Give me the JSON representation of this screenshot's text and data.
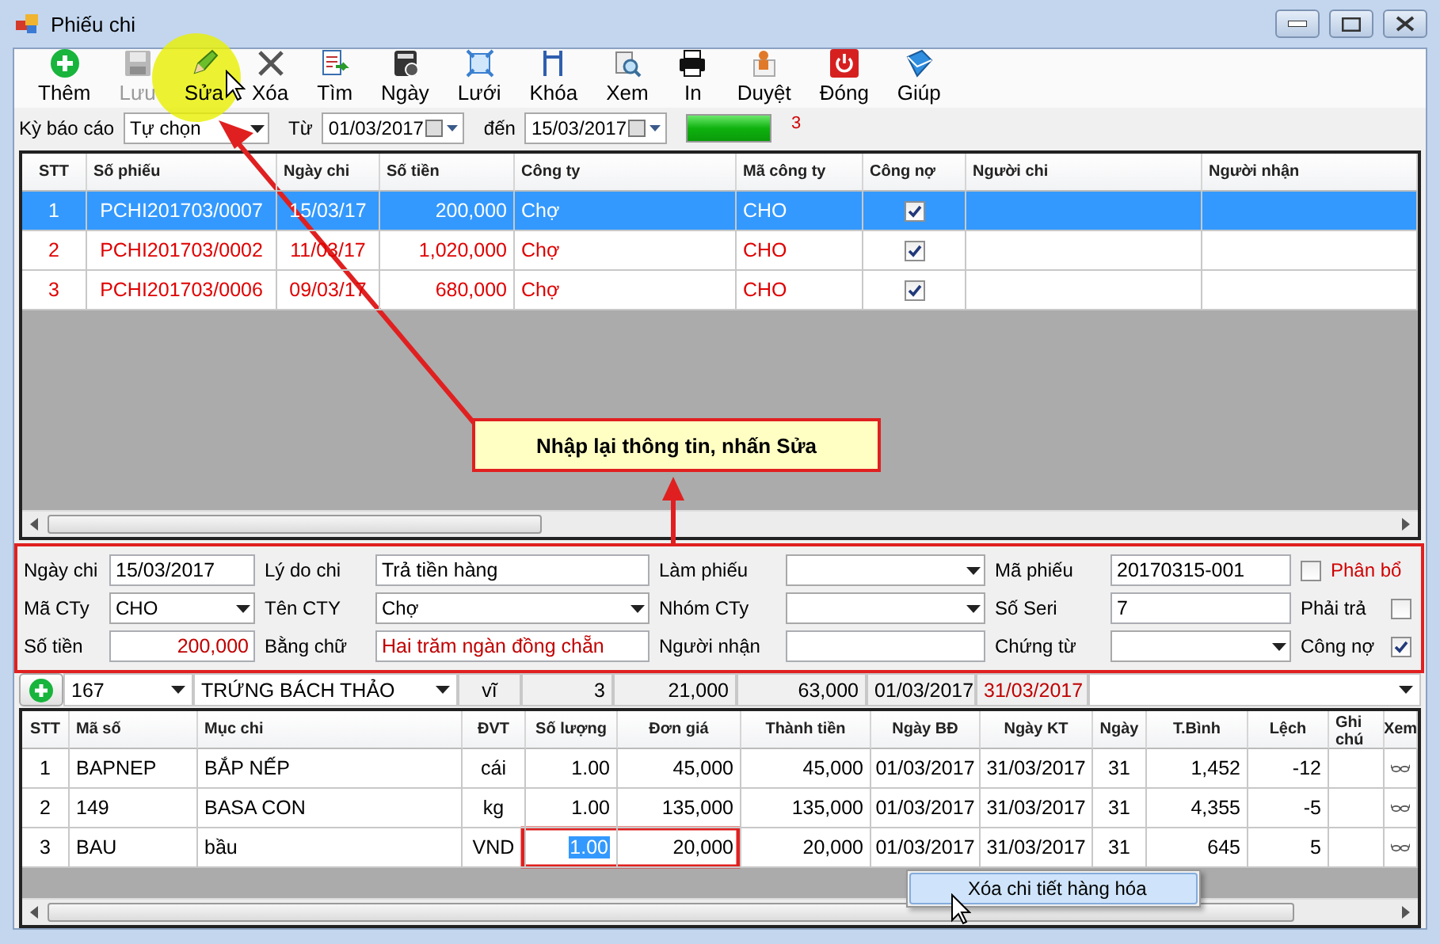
{
  "window": {
    "title": "Phiếu chi"
  },
  "toolbar": [
    {
      "label": "Thêm",
      "kind": "add",
      "disabled": false
    },
    {
      "label": "Lưu",
      "kind": "save",
      "disabled": true
    },
    {
      "label": "Sửa",
      "kind": "edit",
      "disabled": false
    },
    {
      "label": "Xóa",
      "kind": "delete",
      "disabled": false
    },
    {
      "label": "Tìm",
      "kind": "find",
      "disabled": false
    },
    {
      "label": "Ngày",
      "kind": "date",
      "disabled": false
    },
    {
      "label": "Lưới",
      "kind": "grid",
      "disabled": false
    },
    {
      "label": "Khóa",
      "kind": "lock",
      "disabled": false
    },
    {
      "label": "Xem",
      "kind": "preview",
      "disabled": false
    },
    {
      "label": "In",
      "kind": "print",
      "disabled": false
    },
    {
      "label": "Duyệt",
      "kind": "approve",
      "disabled": false
    },
    {
      "label": "Đóng",
      "kind": "close",
      "disabled": false
    },
    {
      "label": "Giúp",
      "kind": "help",
      "disabled": false
    }
  ],
  "filter": {
    "period_label": "Kỳ báo cáo",
    "period": "Tự chọn",
    "from_label": "Từ",
    "from": "01/03/2017",
    "to_label": "đến",
    "to": "15/03/2017",
    "progress": {
      "level": 1
    },
    "count": "3"
  },
  "vouchers": {
    "columns": [
      "STT",
      "Số phiếu",
      "Ngày chi",
      "Số tiền",
      "Công ty",
      "Mã công ty",
      "Công nợ",
      "Người chi",
      "Người nhận"
    ],
    "rows": [
      {
        "stt": "1",
        "number": "PCHI201703/0007",
        "date": "15/03/17",
        "amount": "200,000",
        "company": "Chợ",
        "code": "CHO",
        "debt": true,
        "selected": true
      },
      {
        "stt": "2",
        "number": "PCHI201703/0002",
        "date": "11/03/17",
        "amount": "1,020,000",
        "company": "Chợ",
        "code": "CHO",
        "debt": true,
        "selected": false
      },
      {
        "stt": "3",
        "number": "PCHI201703/0006",
        "date": "09/03/17",
        "amount": "680,000",
        "company": "Chợ",
        "code": "CHO",
        "debt": true,
        "selected": false
      }
    ]
  },
  "form": {
    "rows": [
      {
        "fields": [
          {
            "label": "Ngày chi",
            "kind": "text",
            "value": "15/03/2017"
          },
          {
            "label": "Lý do chi",
            "kind": "text",
            "value": "Trả tiền hàng"
          },
          {
            "label": "Làm phiếu",
            "kind": "combo"
          },
          {
            "label": "Mã phiếu",
            "kind": "text",
            "value": "20170315-001"
          }
        ],
        "option": {
          "label": "Phân bổ",
          "checked": false,
          "box_first": true,
          "alert": true
        }
      },
      {
        "fields": [
          {
            "label": "Mã CTy",
            "kind": "combo",
            "value": "CHO"
          },
          {
            "label": "Tên CTY",
            "kind": "combo",
            "value": "Chợ"
          },
          {
            "label": "Nhóm CTy",
            "kind": "combo"
          },
          {
            "label": "Số Seri",
            "kind": "text",
            "value": "7"
          }
        ],
        "option": {
          "label": "Phải trả",
          "checked": false,
          "box_first": false,
          "alert": false
        }
      },
      {
        "fields": [
          {
            "label": "Số tiền",
            "kind": "text",
            "value": "200,000",
            "alert": true,
            "numeric": true
          },
          {
            "label": "Bằng chữ",
            "kind": "text",
            "value": "Hai trăm ngàn đồng chẵn",
            "alert": true
          },
          {
            "label": "Người nhận",
            "kind": "text"
          },
          {
            "label": "Chứng từ",
            "kind": "combo"
          }
        ],
        "option": {
          "label": "Công nợ",
          "checked": true,
          "box_first": false,
          "alert": false
        }
      }
    ]
  },
  "entry": {
    "code": "167",
    "item": "TRỨNG BÁCH THẢO",
    "unit": "vĩ",
    "quantity": "3",
    "price": "21,000",
    "total": "63,000",
    "start": "01/03/2017",
    "end": "31/03/2017"
  },
  "details": {
    "columns": [
      "STT",
      "Mã số",
      "Mục chi",
      "ĐVT",
      "Số lượng",
      "Đơn giá",
      "Thành tiền",
      "Ngày BĐ",
      "Ngày KT",
      "Ngày",
      "T.Bình",
      "Lệch",
      "Ghi chú",
      "Xem"
    ],
    "rows": [
      {
        "cells": [
          "1",
          "BAPNEP",
          "BẮP NẾP",
          "cái",
          "1.00",
          "45,000",
          "45,000",
          "01/03/2017",
          "31/03/2017",
          "31",
          "1,452",
          "-12"
        ],
        "quantity_selected": false
      },
      {
        "cells": [
          "2",
          "149",
          "BASA CON",
          "kg",
          "1.00",
          "135,000",
          "135,000",
          "01/03/2017",
          "31/03/2017",
          "31",
          "4,355",
          "-5"
        ],
        "quantity_selected": false
      },
      {
        "cells": [
          "3",
          "BAU",
          "bầu",
          "VND",
          "1.00",
          "20,000",
          "20,000",
          "01/03/2017",
          "31/03/2017",
          "31",
          "645",
          "5"
        ],
        "quantity_selected": true
      }
    ]
  },
  "context_menu": {
    "items": [
      "Xóa chi tiết hàng hóa"
    ]
  },
  "annotation": {
    "callout": "Nhập lại thông tin, nhấn Sửa"
  }
}
